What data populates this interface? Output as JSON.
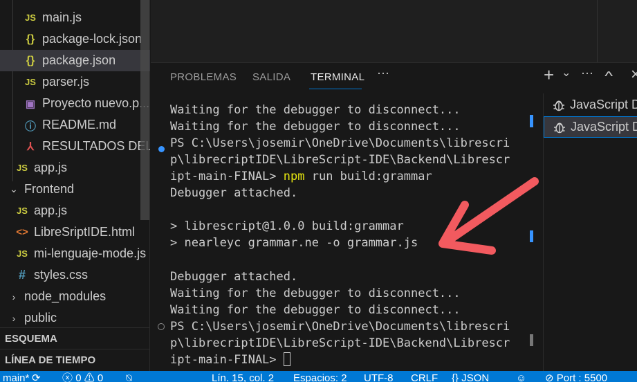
{
  "explorer": {
    "items": [
      {
        "label": "main.js",
        "icon": "js-file-icon",
        "glyph": "JS",
        "type": "js"
      },
      {
        "label": "package-lock.json",
        "icon": "json-file-icon",
        "glyph": "{}",
        "type": "json"
      },
      {
        "label": "package.json",
        "icon": "json-file-icon",
        "glyph": "{}",
        "type": "json"
      },
      {
        "label": "parser.js",
        "icon": "js-file-icon",
        "glyph": "JS",
        "type": "js"
      },
      {
        "label": "Proyecto nuevo.p...",
        "icon": "image-file-icon",
        "glyph": "▣",
        "type": "img"
      },
      {
        "label": "README.md",
        "icon": "info-file-icon",
        "glyph": "ⓘ",
        "type": "md"
      },
      {
        "label": "RESULTADOS DEL...",
        "icon": "pdf-file-icon",
        "glyph": "⅄",
        "type": "pdf"
      },
      {
        "label": "app.js",
        "icon": "js-file-icon",
        "glyph": "JS",
        "type": "js"
      },
      {
        "label": "Frontend",
        "icon": "chevron-down-icon",
        "glyph": "⌄",
        "type": "folder-open"
      },
      {
        "label": "app.js",
        "icon": "js-file-icon",
        "glyph": "JS",
        "type": "js"
      },
      {
        "label": "LibreSriptIDE.html",
        "icon": "html-file-icon",
        "glyph": "<>",
        "type": "html"
      },
      {
        "label": "mi-lenguaje-mode.js",
        "icon": "js-file-icon",
        "glyph": "JS",
        "type": "js"
      },
      {
        "label": "styles.css",
        "icon": "css-file-icon",
        "glyph": "#",
        "type": "css"
      },
      {
        "label": "node_modules",
        "icon": "chevron-right-icon",
        "glyph": "›",
        "type": "folder"
      },
      {
        "label": "public",
        "icon": "chevron-right-icon",
        "glyph": "›",
        "type": "folder"
      }
    ],
    "sections": {
      "outline": "ESQUEMA",
      "timeline": "LÍNEA DE TIEMPO"
    }
  },
  "panel": {
    "tabs": [
      "PROBLEMAS",
      "SALIDA",
      "TERMINAL"
    ],
    "active_tab": "TERMINAL",
    "more": "···",
    "actions": {
      "add": "+",
      "dropdown": "⌄",
      "more": "···",
      "maximize": "^",
      "close": "×"
    }
  },
  "terminal": {
    "lines": [
      "Waiting for the debugger to disconnect...",
      "Waiting for the debugger to disconnect...",
      "PS C:\\Users\\josemir\\OneDrive\\Documents\\librescri",
      "p\\librecriptIDE\\LibreScript-IDE\\Backend\\Librescr",
      "ipt-main-FINAL>",
      "Debugger attached.",
      "",
      "> librescript@1.0.0 build:grammar",
      "> nearleyc grammar.ne -o grammar.js",
      "",
      "Debugger attached.",
      "Waiting for the debugger to disconnect...",
      "Waiting for the debugger to disconnect...",
      "PS C:\\Users\\josemir\\OneDrive\\Documents\\librescri",
      "p\\librecriptIDE\\LibreScript-IDE\\Backend\\Librescr",
      "ipt-main-FINAL>"
    ],
    "command_npm": "npm",
    "command_rest": " run build:grammar"
  },
  "terminal_list": {
    "items": [
      "JavaScript Debug",
      "JavaScript Debug"
    ]
  },
  "statusbar": {
    "branch": "main*",
    "sync": "⟳",
    "errors": "0",
    "warnings": "0",
    "position": "Lín. 15, col. 2",
    "spaces": "Espacios: 2",
    "encoding": "UTF-8",
    "eol": "CRLF",
    "language_glyph": "{}",
    "language": "JSON",
    "port": "Port : 5500"
  },
  "colors": {
    "accent": "#0078d4",
    "annotation_arrow": "#f25a5f"
  }
}
